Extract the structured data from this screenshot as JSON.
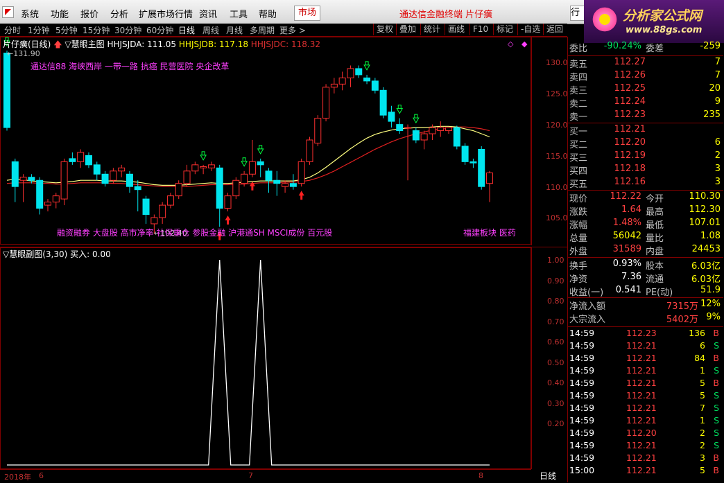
{
  "menu": {
    "items": [
      "系统",
      "功能",
      "报价",
      "分析",
      "扩展市场行情",
      "资讯",
      "工具",
      "帮助"
    ],
    "market_button": "市场",
    "title": "通达信金融终端  片仔癀",
    "right_button": "行"
  },
  "brand": {
    "name": "分析家公式网",
    "url": "www.88gs.com"
  },
  "periods": [
    "分时",
    "1分钟",
    "5分钟",
    "15分钟",
    "30分钟",
    "60分钟",
    "日线",
    "周线",
    "月线",
    "多周期",
    "更多 >"
  ],
  "toolbar": [
    "复权",
    "叠加",
    "统计",
    "画线",
    "F10",
    "标记",
    "-自选",
    "返回"
  ],
  "main_chart": {
    "stock_label": "片仔癀(日线)",
    "indicator_name": "慧眼主图",
    "hhjsjda_label": "HHJSJDA: 111.05",
    "hhjsjdb_label": "HHJSJDB: 117.18",
    "hhjsjdc_label": "HHJSJDC: 118.32",
    "high_marker": "131.90",
    "low_marker": "102.40",
    "concepts_top": "通达信88 海峡西岸 一带一路 抗癌 民营医院 央企改革",
    "concepts_bottom": "融资融券 大盘股 高市净率 社保重仓 参股金融 沪港通SH MSCI成份 百元股",
    "concepts_bottom_right": "福建板块 医药",
    "yticks": [
      "130.0",
      "125.0",
      "120.0",
      "115.0",
      "110.0",
      "105.0"
    ],
    "colors": {
      "up": "#ff3030",
      "down": "#00e5ee",
      "ma_yellow": "#ffff80",
      "ma_red": "#e02020"
    }
  },
  "chart_data": {
    "type": "candlestick",
    "ylim": [
      102,
      133
    ],
    "candles": [
      {
        "o": 131.5,
        "h": 131.9,
        "l": 119.0,
        "c": 119.5
      },
      {
        "o": 114.0,
        "h": 114.5,
        "l": 107.5,
        "c": 110.0
      },
      {
        "o": 111.0,
        "h": 112.0,
        "l": 107.5,
        "c": 111.5
      },
      {
        "o": 111.5,
        "h": 112.0,
        "l": 110.5,
        "c": 111.0
      },
      {
        "o": 111.0,
        "h": 111.5,
        "l": 105.5,
        "c": 106.5
      },
      {
        "o": 107.0,
        "h": 108.0,
        "l": 106.0,
        "c": 107.5
      },
      {
        "o": 107.5,
        "h": 109.0,
        "l": 106.5,
        "c": 108.5
      },
      {
        "o": 108.0,
        "h": 114.5,
        "l": 107.0,
        "c": 114.0
      },
      {
        "o": 114.5,
        "h": 115.5,
        "l": 113.5,
        "c": 114.0
      },
      {
        "o": 114.0,
        "h": 116.0,
        "l": 113.0,
        "c": 115.5
      },
      {
        "o": 115.0,
        "h": 115.5,
        "l": 113.0,
        "c": 113.5
      },
      {
        "o": 113.5,
        "h": 114.0,
        "l": 111.0,
        "c": 112.0
      },
      {
        "o": 112.0,
        "h": 112.5,
        "l": 110.0,
        "c": 110.5
      },
      {
        "o": 111.0,
        "h": 113.0,
        "l": 110.5,
        "c": 112.5
      },
      {
        "o": 112.5,
        "h": 113.5,
        "l": 111.5,
        "c": 113.0
      },
      {
        "o": 112.0,
        "h": 112.5,
        "l": 109.0,
        "c": 110.0
      },
      {
        "o": 110.0,
        "h": 111.0,
        "l": 106.0,
        "c": 109.5
      },
      {
        "o": 108.0,
        "h": 108.5,
        "l": 104.0,
        "c": 105.5
      },
      {
        "o": 104.0,
        "h": 105.5,
        "l": 102.4,
        "c": 105.0
      },
      {
        "o": 105.0,
        "h": 107.5,
        "l": 104.0,
        "c": 107.0
      },
      {
        "o": 107.0,
        "h": 109.0,
        "l": 106.5,
        "c": 108.5
      },
      {
        "o": 108.5,
        "h": 111.0,
        "l": 108.0,
        "c": 110.5
      },
      {
        "o": 110.5,
        "h": 113.5,
        "l": 110.0,
        "c": 112.5
      },
      {
        "o": 112.5,
        "h": 114.0,
        "l": 112.0,
        "c": 113.5
      },
      {
        "o": 113.0,
        "h": 113.5,
        "l": 112.0,
        "c": 113.2
      },
      {
        "o": 113.0,
        "h": 114.0,
        "l": 112.5,
        "c": 113.5
      },
      {
        "o": 113.0,
        "h": 113.5,
        "l": 103.5,
        "c": 106.5
      },
      {
        "o": 106.5,
        "h": 109.0,
        "l": 106.0,
        "c": 108.5
      },
      {
        "o": 108.5,
        "h": 111.5,
        "l": 108.0,
        "c": 111.0
      },
      {
        "o": 110.5,
        "h": 112.5,
        "l": 110.0,
        "c": 112.0
      },
      {
        "o": 112.0,
        "h": 117.5,
        "l": 111.5,
        "c": 114.0
      },
      {
        "o": 114.0,
        "h": 114.5,
        "l": 111.5,
        "c": 113.5
      },
      {
        "o": 112.5,
        "h": 113.0,
        "l": 109.0,
        "c": 111.0
      },
      {
        "o": 111.0,
        "h": 112.5,
        "l": 108.5,
        "c": 110.5
      },
      {
        "o": 110.0,
        "h": 111.0,
        "l": 109.0,
        "c": 110.5
      },
      {
        "o": 110.5,
        "h": 112.0,
        "l": 109.5,
        "c": 110.0
      },
      {
        "o": 110.5,
        "h": 114.5,
        "l": 110.0,
        "c": 114.0
      },
      {
        "o": 114.0,
        "h": 118.0,
        "l": 113.5,
        "c": 117.5
      },
      {
        "o": 117.0,
        "h": 121.5,
        "l": 116.5,
        "c": 121.0
      },
      {
        "o": 121.0,
        "h": 126.5,
        "l": 120.5,
        "c": 126.0
      },
      {
        "o": 126.0,
        "h": 127.5,
        "l": 125.0,
        "c": 126.5
      },
      {
        "o": 126.5,
        "h": 128.5,
        "l": 125.5,
        "c": 127.5
      },
      {
        "o": 127.5,
        "h": 129.5,
        "l": 126.0,
        "c": 129.0
      },
      {
        "o": 129.0,
        "h": 129.5,
        "l": 127.5,
        "c": 128.0
      },
      {
        "o": 127.5,
        "h": 128.0,
        "l": 126.5,
        "c": 127.0
      },
      {
        "o": 127.0,
        "h": 127.5,
        "l": 125.0,
        "c": 125.5
      },
      {
        "o": 125.5,
        "h": 126.0,
        "l": 121.0,
        "c": 121.5
      },
      {
        "o": 122.0,
        "h": 123.0,
        "l": 119.5,
        "c": 120.5
      },
      {
        "o": 120.0,
        "h": 121.0,
        "l": 118.5,
        "c": 119.0
      },
      {
        "o": 119.5,
        "h": 120.0,
        "l": 111.0,
        "c": 119.5
      },
      {
        "o": 119.0,
        "h": 119.5,
        "l": 117.0,
        "c": 117.5
      },
      {
        "o": 117.5,
        "h": 119.0,
        "l": 116.0,
        "c": 118.5
      },
      {
        "o": 118.5,
        "h": 120.0,
        "l": 117.5,
        "c": 119.5
      },
      {
        "o": 119.0,
        "h": 120.5,
        "l": 118.0,
        "c": 119.5
      },
      {
        "o": 119.0,
        "h": 119.5,
        "l": 118.5,
        "c": 119.5
      },
      {
        "o": 119.5,
        "h": 119.8,
        "l": 116.0,
        "c": 116.5
      },
      {
        "o": 116.5,
        "h": 117.0,
        "l": 113.5,
        "c": 114.0
      },
      {
        "o": 114.0,
        "h": 114.5,
        "l": 113.0,
        "c": 113.8
      },
      {
        "o": 116.0,
        "h": 116.5,
        "l": 109.5,
        "c": 110.0
      },
      {
        "o": 110.5,
        "h": 112.5,
        "l": 107.5,
        "c": 112.2
      }
    ],
    "ma_yellow": [
      111.0,
      111.2,
      111.1,
      110.9,
      110.8,
      110.7,
      110.6,
      110.7,
      110.8,
      111.0,
      111.0,
      111.0,
      110.9,
      110.9,
      110.9,
      110.8,
      110.7,
      110.5,
      110.3,
      110.2,
      110.2,
      110.2,
      110.3,
      110.4,
      110.5,
      110.6,
      110.5,
      110.5,
      110.6,
      110.7,
      110.8,
      110.9,
      110.9,
      110.9,
      110.9,
      110.9,
      111.1,
      111.5,
      112.2,
      113.1,
      114.1,
      115.1,
      116.1,
      117.0,
      117.8,
      118.4,
      118.8,
      119.1,
      119.3,
      119.4,
      119.5,
      119.5,
      119.6,
      119.7,
      119.7,
      119.6,
      119.3,
      119.0,
      118.5,
      118.0
    ],
    "ma_red": [
      110.5,
      110.6,
      110.6,
      110.6,
      110.5,
      110.5,
      110.4,
      110.4,
      110.5,
      110.6,
      110.6,
      110.6,
      110.6,
      110.5,
      110.5,
      110.4,
      110.3,
      110.2,
      110.1,
      110.0,
      110.0,
      110.0,
      110.0,
      110.1,
      110.2,
      110.3,
      110.3,
      110.3,
      110.4,
      110.4,
      110.5,
      110.6,
      110.6,
      110.6,
      110.7,
      110.7,
      110.8,
      111.0,
      111.4,
      111.9,
      112.5,
      113.2,
      113.9,
      114.6,
      115.3,
      116.0,
      116.6,
      117.2,
      117.7,
      118.1,
      118.5,
      118.8,
      119.1,
      119.3,
      119.5,
      119.6,
      119.6,
      119.5,
      119.3,
      119.0
    ]
  },
  "sub_chart": {
    "title": "慧眼副图(3,30)",
    "buy_label": "买入: 0.00",
    "yticks": [
      "1.00",
      "0.90",
      "0.80",
      "0.70",
      "0.60",
      "0.50",
      "0.40",
      "0.30",
      "0.20"
    ],
    "spike_at": [
      26,
      31
    ]
  },
  "timeline": {
    "labels": [
      "2018年",
      "6",
      "7",
      "8"
    ],
    "period_label": "日线"
  },
  "quote": {
    "weibi_label": "委比",
    "weibi": "-90.24%",
    "weicha_label": "委差",
    "weicha": "-259",
    "sell": [
      {
        "label": "卖五",
        "price": "112.27",
        "vol": "7"
      },
      {
        "label": "卖四",
        "price": "112.26",
        "vol": "7"
      },
      {
        "label": "卖三",
        "price": "112.25",
        "vol": "20"
      },
      {
        "label": "卖二",
        "price": "112.24",
        "vol": "9"
      },
      {
        "label": "卖一",
        "price": "112.23",
        "vol": "235"
      }
    ],
    "buy": [
      {
        "label": "买一",
        "price": "112.21",
        "vol": ""
      },
      {
        "label": "买二",
        "price": "112.20",
        "vol": "6"
      },
      {
        "label": "买三",
        "price": "112.19",
        "vol": "2"
      },
      {
        "label": "买四",
        "price": "112.18",
        "vol": "3"
      },
      {
        "label": "买五",
        "price": "112.16",
        "vol": "3"
      }
    ],
    "stats": [
      {
        "l1": "现价",
        "v1": "112.22",
        "c1": "red",
        "l2": "今开",
        "v2": "110.30",
        "c2": "green"
      },
      {
        "l1": "涨跌",
        "v1": "1.64",
        "c1": "red",
        "l2": "最高",
        "v2": "112.30",
        "c2": "red"
      },
      {
        "l1": "涨幅",
        "v1": "1.48%",
        "c1": "red",
        "l2": "最低",
        "v2": "107.01",
        "c2": "green"
      },
      {
        "l1": "总量",
        "v1": "56042",
        "c1": "yellow",
        "l2": "量比",
        "v2": "1.08",
        "c2": "red"
      },
      {
        "l1": "外盘",
        "v1": "31589",
        "c1": "red",
        "l2": "内盘",
        "v2": "24453",
        "c2": "green"
      }
    ],
    "stats2": [
      {
        "l1": "换手",
        "v1": "0.93%",
        "l2": "股本",
        "v2": "6.03亿"
      },
      {
        "l1": "净资",
        "v1": "7.36",
        "l2": "流通",
        "v2": "6.03亿"
      },
      {
        "l1": "收益(一)",
        "v1": "0.541",
        "l2": "PE(动)",
        "v2": "51.9"
      }
    ],
    "flow": [
      {
        "label": "净流入额",
        "value": "7315万",
        "pct": "12%"
      },
      {
        "label": "大宗流入",
        "value": "5402万",
        "pct": "9%"
      }
    ],
    "ticks": [
      {
        "t": "14:59",
        "p": "112.23",
        "v": "136",
        "f": "B"
      },
      {
        "t": "14:59",
        "p": "112.21",
        "v": "6",
        "f": "S"
      },
      {
        "t": "14:59",
        "p": "112.21",
        "v": "84",
        "f": "B"
      },
      {
        "t": "14:59",
        "p": "112.21",
        "v": "1",
        "f": "S"
      },
      {
        "t": "14:59",
        "p": "112.21",
        "v": "5",
        "f": "B"
      },
      {
        "t": "14:59",
        "p": "112.21",
        "v": "5",
        "f": "S"
      },
      {
        "t": "14:59",
        "p": "112.21",
        "v": "7",
        "f": "S"
      },
      {
        "t": "14:59",
        "p": "112.21",
        "v": "1",
        "f": "S"
      },
      {
        "t": "14:59",
        "p": "112.20",
        "v": "2",
        "f": "S"
      },
      {
        "t": "14:59",
        "p": "112.21",
        "v": "2",
        "f": "S"
      },
      {
        "t": "14:59",
        "p": "112.21",
        "v": "3",
        "f": "B"
      },
      {
        "t": "15:00",
        "p": "112.21",
        "v": "5",
        "f": "B"
      }
    ]
  }
}
